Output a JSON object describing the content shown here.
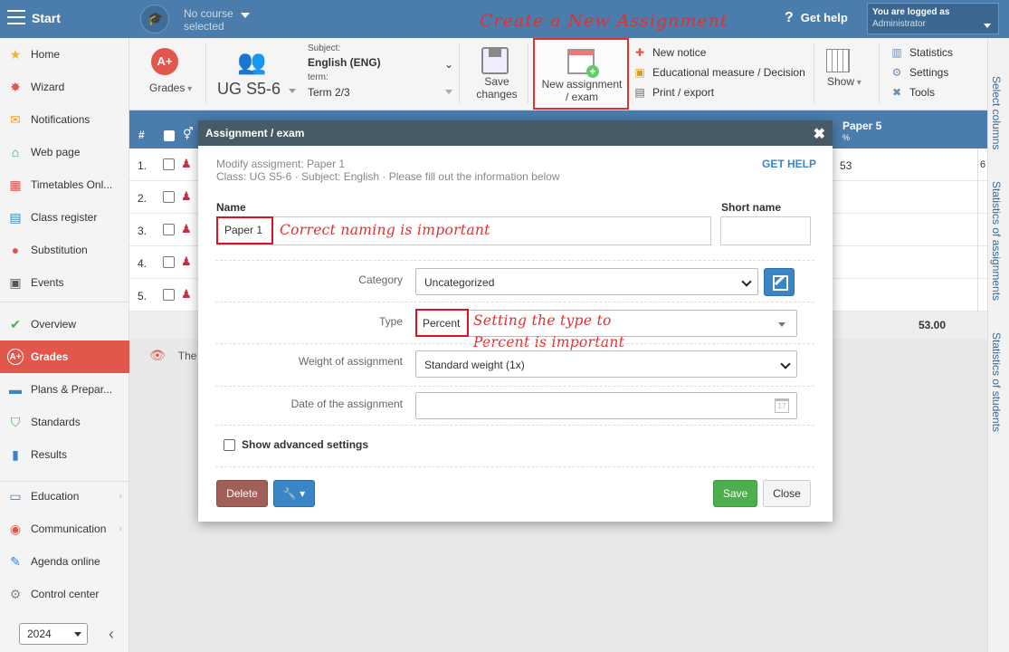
{
  "topbar": {
    "start_label": "Start",
    "course_label_1": "No course",
    "course_label_2": "selected",
    "annotation": "Create a New Assignment",
    "help_label": "Get help",
    "logged_label": "You are logged as",
    "user_role": "Administrator"
  },
  "sidebar": {
    "items": [
      {
        "label": "Home",
        "icon": "star-icon",
        "glyph": "★",
        "color": "#f0b429"
      },
      {
        "label": "Wizard",
        "icon": "wand-icon",
        "glyph": "✸",
        "color": "#e2574c"
      },
      {
        "label": "Notifications",
        "icon": "envelope-icon",
        "glyph": "✉",
        "color": "#f0a030"
      },
      {
        "label": "Web page",
        "icon": "house-icon",
        "glyph": "⌂",
        "color": "#2a9d6a"
      },
      {
        "label": "Timetables Onl...",
        "icon": "timetable-icon",
        "glyph": "▦",
        "color": "#d9534f"
      },
      {
        "label": "Class register",
        "icon": "register-icon",
        "glyph": "▤",
        "color": "#3a85c5"
      },
      {
        "label": "Substitution",
        "icon": "substitution-icon",
        "glyph": "●",
        "color": "#e2574c"
      },
      {
        "label": "Events",
        "icon": "calendar-icon",
        "glyph": "▣",
        "color": "#555555"
      },
      {
        "label": "Overview",
        "icon": "check-circle-icon",
        "glyph": "✔",
        "color": "#4cae4c"
      },
      {
        "label": "Grades",
        "icon": "grades-icon",
        "glyph": "A+",
        "color": "#ffffff"
      },
      {
        "label": "Plans & Prepar...",
        "icon": "plans-icon",
        "glyph": "▬",
        "color": "#3a85c5"
      },
      {
        "label": "Standards",
        "icon": "shield-icon",
        "glyph": "⛉",
        "color": "#4cae4c"
      },
      {
        "label": "Results",
        "icon": "bar-chart-icon",
        "glyph": "▮",
        "color": "#3a85c5"
      },
      {
        "label": "Education",
        "icon": "book-icon",
        "glyph": "▭",
        "color": "#3a85c5"
      },
      {
        "label": "Communication",
        "icon": "chat-icon",
        "glyph": "◉",
        "color": "#e2574c"
      },
      {
        "label": "Agenda online",
        "icon": "pen-icon",
        "glyph": "✎",
        "color": "#3a85c5"
      },
      {
        "label": "Control center",
        "icon": "gear-icon",
        "glyph": "⚙",
        "color": "#888888"
      }
    ],
    "year": "2024"
  },
  "toolbar": {
    "grades_label": "Grades",
    "class_label": "UG S5-6",
    "subject_caption": "Subject:",
    "subject_value": "English (ENG)",
    "term_caption": "term:",
    "term_value": "Term 2/3",
    "save_label_1": "Save",
    "save_label_2": "changes",
    "new_asg_1": "New assignment",
    "new_asg_2": "/ exam",
    "new_notice": "New notice",
    "edu_measure": "Educational measure / Decision",
    "print_export": "Print / export",
    "show_label": "Show",
    "statistics": "Statistics",
    "settings": "Settings",
    "tools": "Tools"
  },
  "vtabs": {
    "select_columns": "Select columns",
    "stats_assignments": "Statistics of assignments",
    "stats_students": "Statistics of students"
  },
  "table": {
    "hash": "#",
    "paper5": "Paper 5",
    "paper5_unit": "%",
    "rows": [
      {
        "num": "1.",
        "val": "53"
      },
      {
        "num": "2.",
        "val": ""
      },
      {
        "num": "3.",
        "val": ""
      },
      {
        "num": "4.",
        "val": ""
      },
      {
        "num": "5.",
        "val": ""
      }
    ],
    "row1_edge": "6",
    "total": "53.00",
    "warning_text": "The"
  },
  "modal": {
    "title": "Assignment / exam",
    "info_1": "Modify assigment: Paper 1",
    "info_2": "Class: UG S5-6 · Subject: English · Please fill out the information below",
    "get_help": "GET HELP",
    "name_label": "Name",
    "name_value": "Paper 1",
    "name_annotation": "Correct naming is important",
    "short_name_label": "Short name",
    "short_name_value": "",
    "category_label": "Category",
    "category_value": "Uncategorized",
    "type_label": "Type",
    "type_value": "Percent",
    "type_annotation_1": "Setting the type to",
    "type_annotation_2": "Percent is important",
    "weight_label": "Weight of assignment",
    "weight_value": "Standard weight (1x)",
    "date_label": "Date of the assignment",
    "date_value": "",
    "date_icon_text": "17",
    "advanced_label": "Show advanced settings",
    "delete_label": "Delete",
    "save_label": "Save",
    "close_label": "Close"
  }
}
